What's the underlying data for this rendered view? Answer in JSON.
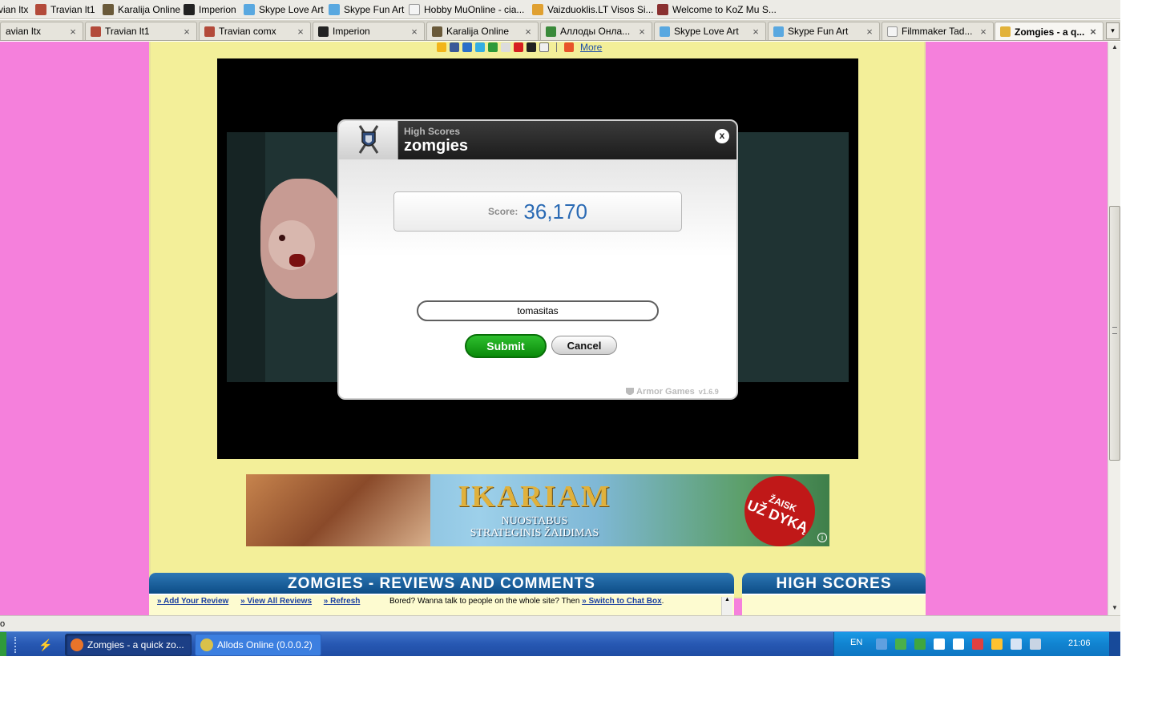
{
  "bookmarks": [
    {
      "label": "vian ltx",
      "icon": "travian-icon",
      "color": "#b34a3a"
    },
    {
      "label": "Travian lt1",
      "icon": "travian-icon",
      "color": "#b34a3a"
    },
    {
      "label": "Karalija Online",
      "icon": "shield-icon",
      "color": "#6a5a3a"
    },
    {
      "label": "Imperion",
      "icon": "imperion-icon",
      "color": "#222222"
    },
    {
      "label": "Skype Love Art",
      "icon": "skype-icon",
      "color": "#59a8e0"
    },
    {
      "label": "Skype Fun Art",
      "icon": "skype-icon",
      "color": "#59a8e0"
    },
    {
      "label": "Hobby MuOnline - cia...",
      "icon": "page-icon",
      "color": "#f4f4f4"
    },
    {
      "label": "Vaizduoklis.LT Visos Si...",
      "icon": "figure-icon",
      "color": "#e0a030"
    },
    {
      "label": "Welcome to KoZ Mu S...",
      "icon": "koz-icon",
      "color": "#8a3030"
    }
  ],
  "tabs": [
    {
      "label": "avian ltx",
      "icon": "travian-icon",
      "color": "#b34a3a",
      "active": false
    },
    {
      "label": "Travian lt1",
      "icon": "travian-icon",
      "color": "#b34a3a",
      "active": false
    },
    {
      "label": "Travian comx",
      "icon": "travian-icon",
      "color": "#b34a3a",
      "active": false
    },
    {
      "label": "Imperion",
      "icon": "imperion-icon",
      "color": "#222222",
      "active": false
    },
    {
      "label": "Karalija Online",
      "icon": "shield-icon",
      "color": "#6a5a3a",
      "active": false
    },
    {
      "label": "Аллоды Онла...",
      "icon": "globe-icon",
      "color": "#3a8a3a",
      "active": false
    },
    {
      "label": "Skype Love Art",
      "icon": "skype-icon",
      "color": "#59a8e0",
      "active": false
    },
    {
      "label": "Skype Fun Art",
      "icon": "skype-icon",
      "color": "#59a8e0",
      "active": false
    },
    {
      "label": "Filmmaker Tad...",
      "icon": "page-icon",
      "color": "#f4f4f4",
      "active": false
    },
    {
      "label": "Zomgies - a q...",
      "icon": "zomgies-icon",
      "color": "#e2b23a",
      "active": true
    }
  ],
  "tab_list_symbol": "▾",
  "share": {
    "more_label": "More"
  },
  "dialog": {
    "subtitle": "High Scores",
    "title": "zomgies",
    "close_label": "x",
    "score_label": "Score:",
    "score_value": "36,170",
    "name_value": "tomasitas",
    "submit_label": "Submit",
    "cancel_label": "Cancel",
    "brand": "Armor Games",
    "version": "v1.6.9"
  },
  "ad": {
    "title": "IKARIAM",
    "line1": "NUOSTABUS",
    "line2": "STRATEGINIS ŽAIDIMAS",
    "badge_top": "ŽAISK",
    "badge_main": "UŽ DYKĄ",
    "info": "i"
  },
  "reviews": {
    "title": "ZOMGIES - REVIEWS AND COMMENTS",
    "link_add": "» Add Your Review",
    "link_view": "» View All Reviews",
    "link_refresh": "» Refresh",
    "chat_text": "Bored? Wanna talk to people on the whole site? Then ",
    "chat_link": "» Switch to Chat Box",
    "chat_end": "."
  },
  "scores": {
    "title": "HIGH SCORES"
  },
  "statusbar": {
    "text": "o"
  },
  "taskbar": {
    "tasks": [
      {
        "label": "Zomgies - a quick zo...",
        "icon": "firefox-icon",
        "color": "#e8742a",
        "active": true
      },
      {
        "label": "Allods Online (0.0.0.2)",
        "icon": "allods-icon",
        "color": "#d9c14a",
        "active": false
      }
    ],
    "lang": "EN",
    "clock": "21:06"
  }
}
